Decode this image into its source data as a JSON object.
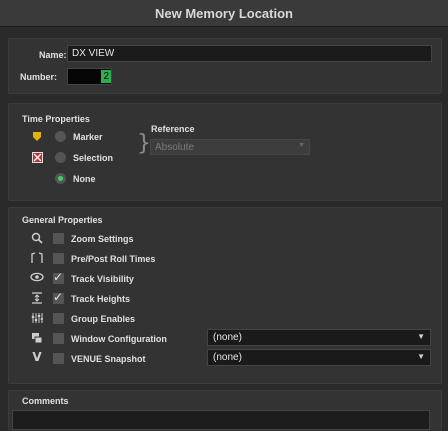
{
  "window": {
    "title": "New Memory Location"
  },
  "name": {
    "label": "Name:",
    "value": "DX VIEW"
  },
  "number": {
    "label": "Number:",
    "value": "2"
  },
  "time_properties": {
    "heading": "Time Properties",
    "options": [
      {
        "label": "Marker",
        "selected": false,
        "icon": "marker-icon"
      },
      {
        "label": "Selection",
        "selected": false,
        "icon": "selection-icon"
      },
      {
        "label": "None",
        "selected": true
      }
    ],
    "reference": {
      "label": "Reference",
      "value": "Absolute"
    }
  },
  "general_properties": {
    "heading": "General Properties",
    "items": [
      {
        "label": "Zoom Settings",
        "checked": false,
        "icon": "magnifier-icon"
      },
      {
        "label": "Pre/Post Roll Times",
        "checked": false,
        "icon": "pre-post-roll-icon"
      },
      {
        "label": "Track Visibility",
        "checked": true,
        "icon": "eye-icon"
      },
      {
        "label": "Track Heights",
        "checked": true,
        "icon": "track-heights-icon"
      },
      {
        "label": "Group Enables",
        "checked": false,
        "icon": "group-enables-icon"
      },
      {
        "label": "Window Configuration",
        "checked": false,
        "icon": "window-config-icon",
        "select": "(none)"
      },
      {
        "label": "VENUE Snapshot",
        "checked": false,
        "icon": "venue-icon",
        "select": "(none)"
      }
    ]
  },
  "comments": {
    "heading": "Comments"
  },
  "colors": {
    "accent_green": "#3fd06a",
    "marker_yellow": "#e8b300",
    "selection_red": "#c0302a"
  }
}
